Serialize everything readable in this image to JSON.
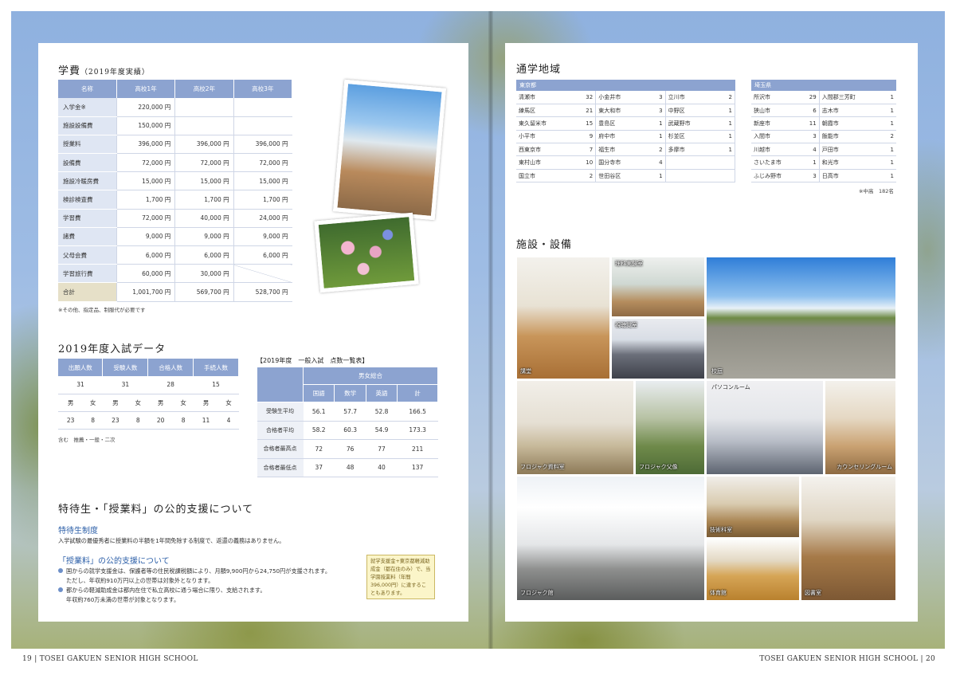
{
  "footer": {
    "left": "19 | TOSEI GAKUEN SENIOR HIGH SCHOOL",
    "right": "TOSEI GAKUEN SENIOR HIGH SCHOOL | 20"
  },
  "fees": {
    "title": "学費",
    "title_note": "（2019年度実績）",
    "headers": [
      "名称",
      "高校1年",
      "高校2年",
      "高校3年"
    ],
    "rows": [
      {
        "name": "入学金※",
        "y1": "220,000 円",
        "y2": "",
        "y3": ""
      },
      {
        "name": "施設設備費",
        "y1": "150,000 円",
        "y2": "",
        "y3": ""
      },
      {
        "name": "授業料",
        "y1": "396,000 円",
        "y2": "396,000 円",
        "y3": "396,000 円"
      },
      {
        "name": "設備費",
        "y1": "72,000 円",
        "y2": "72,000 円",
        "y3": "72,000 円"
      },
      {
        "name": "施設冷暖房費",
        "y1": "15,000 円",
        "y2": "15,000 円",
        "y3": "15,000 円"
      },
      {
        "name": "検診検査費",
        "y1": "1,700 円",
        "y2": "1,700 円",
        "y3": "1,700 円"
      },
      {
        "name": "学習費",
        "y1": "72,000 円",
        "y2": "40,000 円",
        "y3": "24,000 円"
      },
      {
        "name": "諸費",
        "y1": "9,000 円",
        "y2": "9,000 円",
        "y3": "9,000 円"
      },
      {
        "name": "父母会費",
        "y1": "6,000 円",
        "y2": "6,000 円",
        "y3": "6,000 円"
      },
      {
        "name": "学習旅行費",
        "y1": "60,000 円",
        "y2": "30,000 円",
        "y3": ""
      }
    ],
    "total": {
      "name": "合計",
      "y1": "1,001,700 円",
      "y2": "569,700 円",
      "y3": "528,700 円"
    },
    "note": "※その他、指定品、制服代が必要です"
  },
  "entrance": {
    "title": "2019年度入試データ",
    "headers": [
      "出願人数",
      "受験人数",
      "合格人数",
      "手続人数"
    ],
    "totals": [
      "31",
      "31",
      "28",
      "15"
    ],
    "gender": [
      "男",
      "女",
      "男",
      "女",
      "男",
      "女",
      "男",
      "女"
    ],
    "split": [
      "23",
      "8",
      "23",
      "8",
      "20",
      "8",
      "11",
      "4"
    ],
    "note": "含む　推薦・一般・二次"
  },
  "scores": {
    "title": "【2019年度　一般入試　点数一覧表】",
    "group_header": "男女総合",
    "headers": [
      "国語",
      "数学",
      "英語",
      "計"
    ],
    "rows": [
      {
        "label": "受験生平均",
        "values": [
          "56.1",
          "57.7",
          "52.8",
          "166.5"
        ]
      },
      {
        "label": "合格者平均",
        "values": [
          "58.2",
          "60.3",
          "54.9",
          "173.3"
        ]
      },
      {
        "label": "合格者最高点",
        "values": [
          "72",
          "76",
          "77",
          "211"
        ]
      },
      {
        "label": "合格者最低点",
        "values": [
          "37",
          "48",
          "40",
          "137"
        ]
      }
    ]
  },
  "support": {
    "title": "特待生・「授業料」の公的支援について",
    "sub1": "特待生制度",
    "text1": "入学試験の最優秀者に授業料の半額を1年間免除する制度で、返還の義務はありません。",
    "sub2": "「授業料」の公的支援について",
    "b1_line1": "国からの就学支援金は、保護者等の住民税課税額により、月額9,900円から24,750円が支援されます。",
    "b1_line2": "ただし、年収約910万円以上の世帯は対象外となります。",
    "b2_line1": "都からの軽減助成金は都内在住で私立高校に通う場合に限り、支給されます。",
    "b2_line2": "年収約760万未満の世帯が対象となります。",
    "box": "就学支援金+東京都軽減助成金（都在住のみ）で、当学園授業料（年間396,000円）に達することもあります。"
  },
  "commute": {
    "title": "通学地域",
    "tokyo_label": "東京都",
    "tokyo": [
      [
        [
          "清瀬市",
          "32"
        ],
        [
          "小金井市",
          "3"
        ],
        [
          "立川市",
          "2"
        ]
      ],
      [
        [
          "練馬区",
          "21"
        ],
        [
          "東大和市",
          "3"
        ],
        [
          "中野区",
          "1"
        ]
      ],
      [
        [
          "東久留米市",
          "15"
        ],
        [
          "豊島区",
          "1"
        ],
        [
          "武蔵野市",
          "1"
        ]
      ],
      [
        [
          "小平市",
          "9"
        ],
        [
          "府中市",
          "1"
        ],
        [
          "杉並区",
          "1"
        ]
      ],
      [
        [
          "西東京市",
          "7"
        ],
        [
          "福生市",
          "2"
        ],
        [
          "多摩市",
          "1"
        ]
      ],
      [
        [
          "東村山市",
          "10"
        ],
        [
          "国分寺市",
          "4"
        ],
        [
          "",
          ""
        ]
      ],
      [
        [
          "国立市",
          "2"
        ],
        [
          "世田谷区",
          "1"
        ],
        [
          "",
          ""
        ]
      ]
    ],
    "saitama_label": "埼玉県",
    "saitama": [
      [
        [
          "所沢市",
          "29"
        ],
        [
          "入間郡三芳町",
          "1"
        ]
      ],
      [
        [
          "狭山市",
          "6"
        ],
        [
          "志木市",
          "1"
        ]
      ],
      [
        [
          "新座市",
          "11"
        ],
        [
          "朝霞市",
          "1"
        ]
      ],
      [
        [
          "入間市",
          "3"
        ],
        [
          "飯能市",
          "2"
        ]
      ],
      [
        [
          "川越市",
          "4"
        ],
        [
          "戸田市",
          "1"
        ]
      ],
      [
        [
          "さいたま市",
          "1"
        ],
        [
          "和光市",
          "1"
        ]
      ],
      [
        [
          "ふじみ野市",
          "3"
        ],
        [
          "日高市",
          "1"
        ]
      ]
    ],
    "note": "※中高　182名"
  },
  "facilities": {
    "title": "施設・設備",
    "hall": "講堂",
    "lab": "理科実験室",
    "av": "視聴覚室",
    "yard": "校庭",
    "archive": "フロジャク資料室",
    "statue": "フロジャク父像",
    "pc": "パソコンルーム",
    "counseling": "カウンセリングルーム",
    "main": "フロジャク館",
    "tech": "技術科室",
    "gym": "体育館",
    "library": "図書室"
  }
}
